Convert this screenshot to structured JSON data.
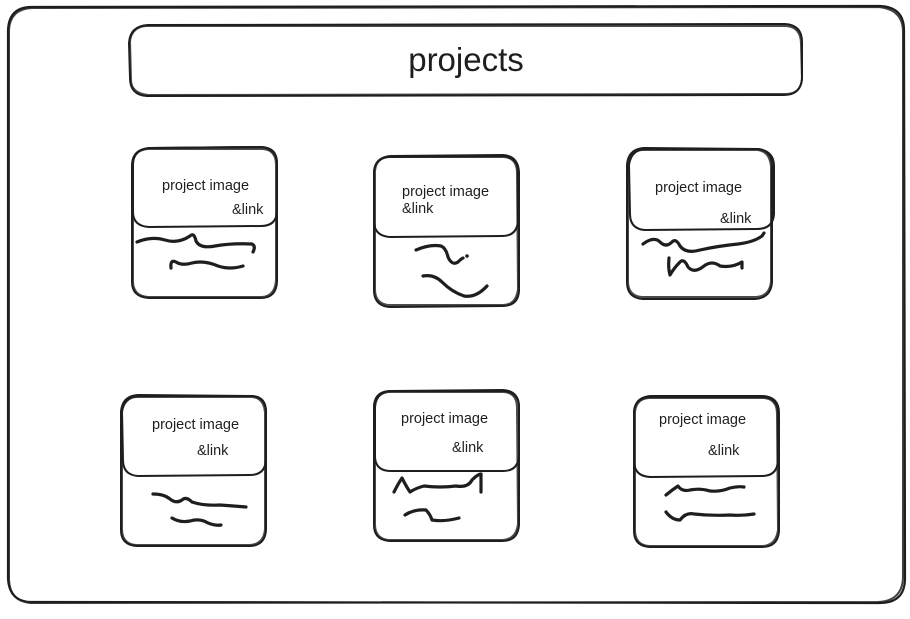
{
  "title": "projects",
  "cards": [
    {
      "image_label": "project image",
      "link_label": "&link"
    },
    {
      "image_label": "project image",
      "link_label": "&link"
    },
    {
      "image_label": "project image",
      "link_label": "&link"
    },
    {
      "image_label": "project image",
      "link_label": "&link"
    },
    {
      "image_label": "project image",
      "link_label": "&link"
    },
    {
      "image_label": "project image",
      "link_label": "&link"
    }
  ],
  "colors": {
    "stroke": "#1e1e1e",
    "background": "#ffffff"
  }
}
